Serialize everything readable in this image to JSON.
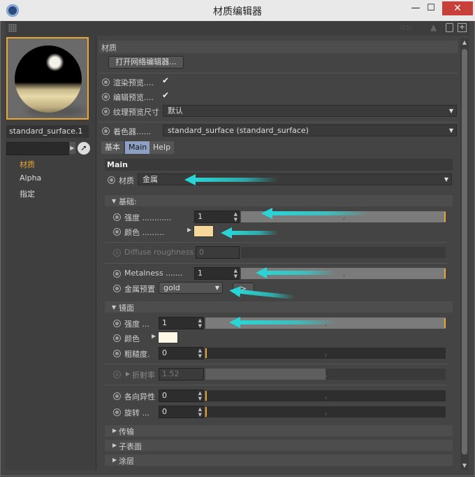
{
  "window": {
    "title": "材质编辑器",
    "minimize": "—",
    "maximize": "☐",
    "close": "✕"
  },
  "left": {
    "material_name": "standard_surface.1",
    "nav": [
      "材质",
      "Alpha",
      "指定"
    ]
  },
  "material": {
    "section_title": "材质",
    "open_node_editor": "打开网络编辑器...",
    "render_preview_label": "渲染预览....",
    "edit_preview_label": "编辑预览....",
    "texture_preview_label": "纹理预览尺寸",
    "texture_preview_value": "默认",
    "shader_label": "着色器......",
    "shader_value": "standard_surface (standard_surface)"
  },
  "tabs": [
    "基本",
    "Main",
    "Help"
  ],
  "main": {
    "title": "Main",
    "material_label": "材质",
    "material_value": "金属",
    "base": {
      "header": "基础:",
      "weight_label": "强度 ............",
      "weight_value": "1",
      "weight_fraction": 1,
      "color_label": "颜色 .........",
      "color": "#f5d89a",
      "diffuse_roughness_label": "Diffuse roughness",
      "diffuse_roughness_value": "0",
      "metalness_label": "Metalness .......",
      "metalness_value": "1",
      "metalness_fraction": 1,
      "metal_preset_label": "金属预置",
      "metal_preset_value": "gold",
      "apply_button": ">"
    },
    "specular": {
      "header": "镜面",
      "weight_label": "强度 ...",
      "weight_value": "1",
      "weight_fraction": 1,
      "color_label": "颜色",
      "color": "#fff8e6",
      "roughness_label": "粗糙度.",
      "roughness_value": "0",
      "ior_label": "折射率",
      "ior_value": "1.52",
      "ior_fraction": 0.5,
      "anisotropy_label": "各向异性",
      "anisotropy_value": "0",
      "rotation_label": "旋转 ...",
      "rotation_value": "0"
    },
    "collapsed_sections": [
      "传输",
      "子表面",
      "涂层"
    ]
  }
}
